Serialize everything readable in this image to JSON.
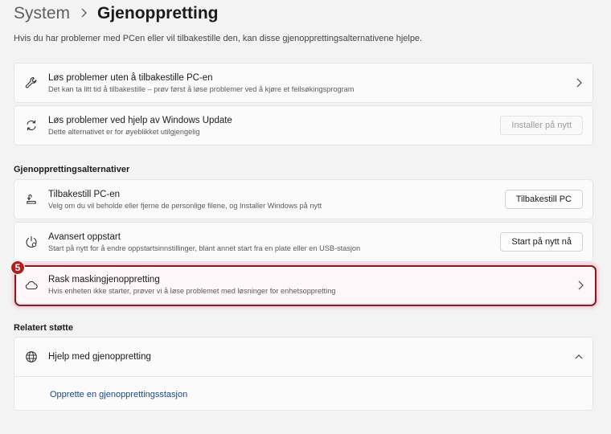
{
  "breadcrumb": {
    "parent": "System",
    "separator_icon": "chevron-right-icon",
    "current": "Gjenoppretting"
  },
  "subtitle": "Hvis du har problemer med PCen eller vil tilbakestille den, kan disse gjenopprettingsalternativene hjelpe.",
  "top_cards": [
    {
      "icon": "wrench-icon",
      "title": "Løs problemer uten å tilbakestille PC-en",
      "desc": "Det kan ta litt tid å tilbakestille – prøv først å løse problemer ved å kjøre et feilsøkingsprogram",
      "action": "chevron-right-icon"
    },
    {
      "icon": "sync-icon",
      "title": "Løs problemer ved hjelp av Windows Update",
      "desc": "Dette alternativet er for øyeblikket utilgjengelig",
      "button": "Installer på nytt",
      "button_disabled": true
    }
  ],
  "recovery_section": {
    "heading": "Gjenopprettingsalternativer",
    "items": [
      {
        "icon": "reset-pc-icon",
        "title": "Tilbakestill PC-en",
        "desc": "Velg om du vil beholde eller fjerne de personlige filene, og Installer Windows på nytt",
        "button": "Tilbakestill PC"
      },
      {
        "icon": "advanced-startup-icon",
        "title": "Avansert oppstart",
        "desc": "Start på nytt for å endre oppstartsinnstillinger, blant annet start fra en plate eller en USB-stasjon",
        "button": "Start på nytt nå"
      },
      {
        "icon": "cloud-icon",
        "title": "Rask maskingjenoppretting",
        "desc": "Hvis enheten ikke starter, prøver vi å løse problemet med løsninger for enhetsoppretting",
        "action": "chevron-right-icon"
      }
    ]
  },
  "annotation": {
    "badge": "5",
    "color": "#b41e1e"
  },
  "related": {
    "heading": "Relatert støtte",
    "help_title": "Hjelp med gjenoppretting",
    "help_icon": "globe-icon",
    "expand_icon": "chevron-up-icon",
    "link": "Opprette en gjenopprettingsstasjon"
  },
  "colors": {
    "background": "#f3f3f3",
    "card": "#fbfbfb",
    "link": "#1a4a8a",
    "highlight_border": "#8c1c1c"
  }
}
